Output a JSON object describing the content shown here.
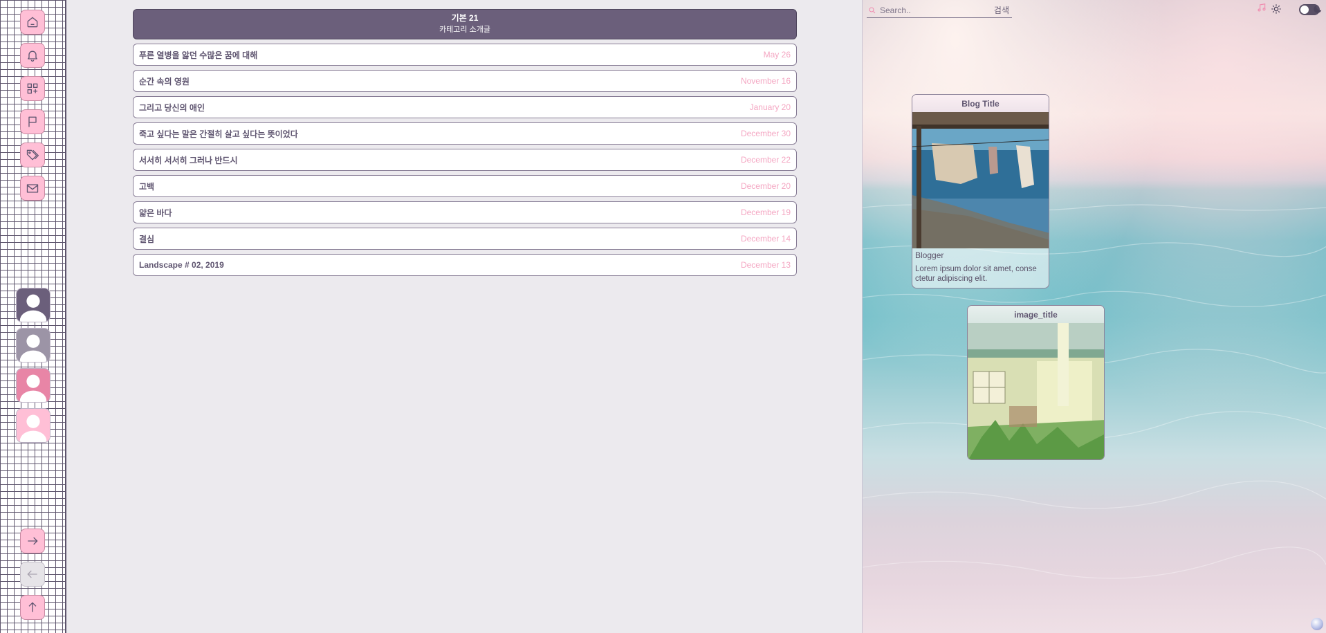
{
  "sidebar": {
    "top_buttons": [
      {
        "icon": "home-icon"
      },
      {
        "icon": "bell-icon"
      },
      {
        "icon": "widgets-icon"
      },
      {
        "icon": "flag-icon"
      },
      {
        "icon": "tags-icon"
      },
      {
        "icon": "mail-icon"
      }
    ],
    "avatars": [
      {
        "color": "#6b5f7b"
      },
      {
        "color": "#9c94a6"
      },
      {
        "color": "#e885a6"
      },
      {
        "color": "#ffbfd6"
      }
    ],
    "bottom_buttons": [
      {
        "icon": "arrow-right-icon",
        "enabled": true
      },
      {
        "icon": "arrow-left-icon",
        "enabled": false
      },
      {
        "icon": "arrow-up-icon",
        "enabled": true
      }
    ]
  },
  "category": {
    "title": "기본 21",
    "subtitle": "카테고리 소개글"
  },
  "posts": [
    {
      "title": "푸른 열병을 앓던 수많은 꿈에 대해",
      "date": "May 26"
    },
    {
      "title": "순간 속의 영원",
      "date": "November 16"
    },
    {
      "title": "그리고 당신의 애인",
      "date": "January 20"
    },
    {
      "title": "죽고 싶다는 말은 간절히 살고 싶다는 뜻이었다",
      "date": "December 30"
    },
    {
      "title": "서서히 서서히 그러나 반드시",
      "date": "December 22"
    },
    {
      "title": "고백",
      "date": "December 20"
    },
    {
      "title": "얇은 바다",
      "date": "December 19"
    },
    {
      "title": "결심",
      "date": "December 14"
    },
    {
      "title": "Landscape # 02, 2019",
      "date": "December 13"
    }
  ],
  "search": {
    "placeholder": "Search..",
    "button_label": "검색"
  },
  "toolbar": {
    "icons": [
      "music-icon",
      "sun-icon",
      "theme-toggle",
      "moon-icon"
    ]
  },
  "blog_card": {
    "title": "Blog Title",
    "author": "Blogger",
    "description": "Lorem ipsum dolor sit amet, conse ctetur adipiscing elit."
  },
  "image_card": {
    "title": "image_title"
  },
  "colors": {
    "accent_pink": "#ffbfd6",
    "header_purple": "#6b5f7b",
    "date_pink": "#f4a6c2",
    "background": "#eceaee"
  }
}
